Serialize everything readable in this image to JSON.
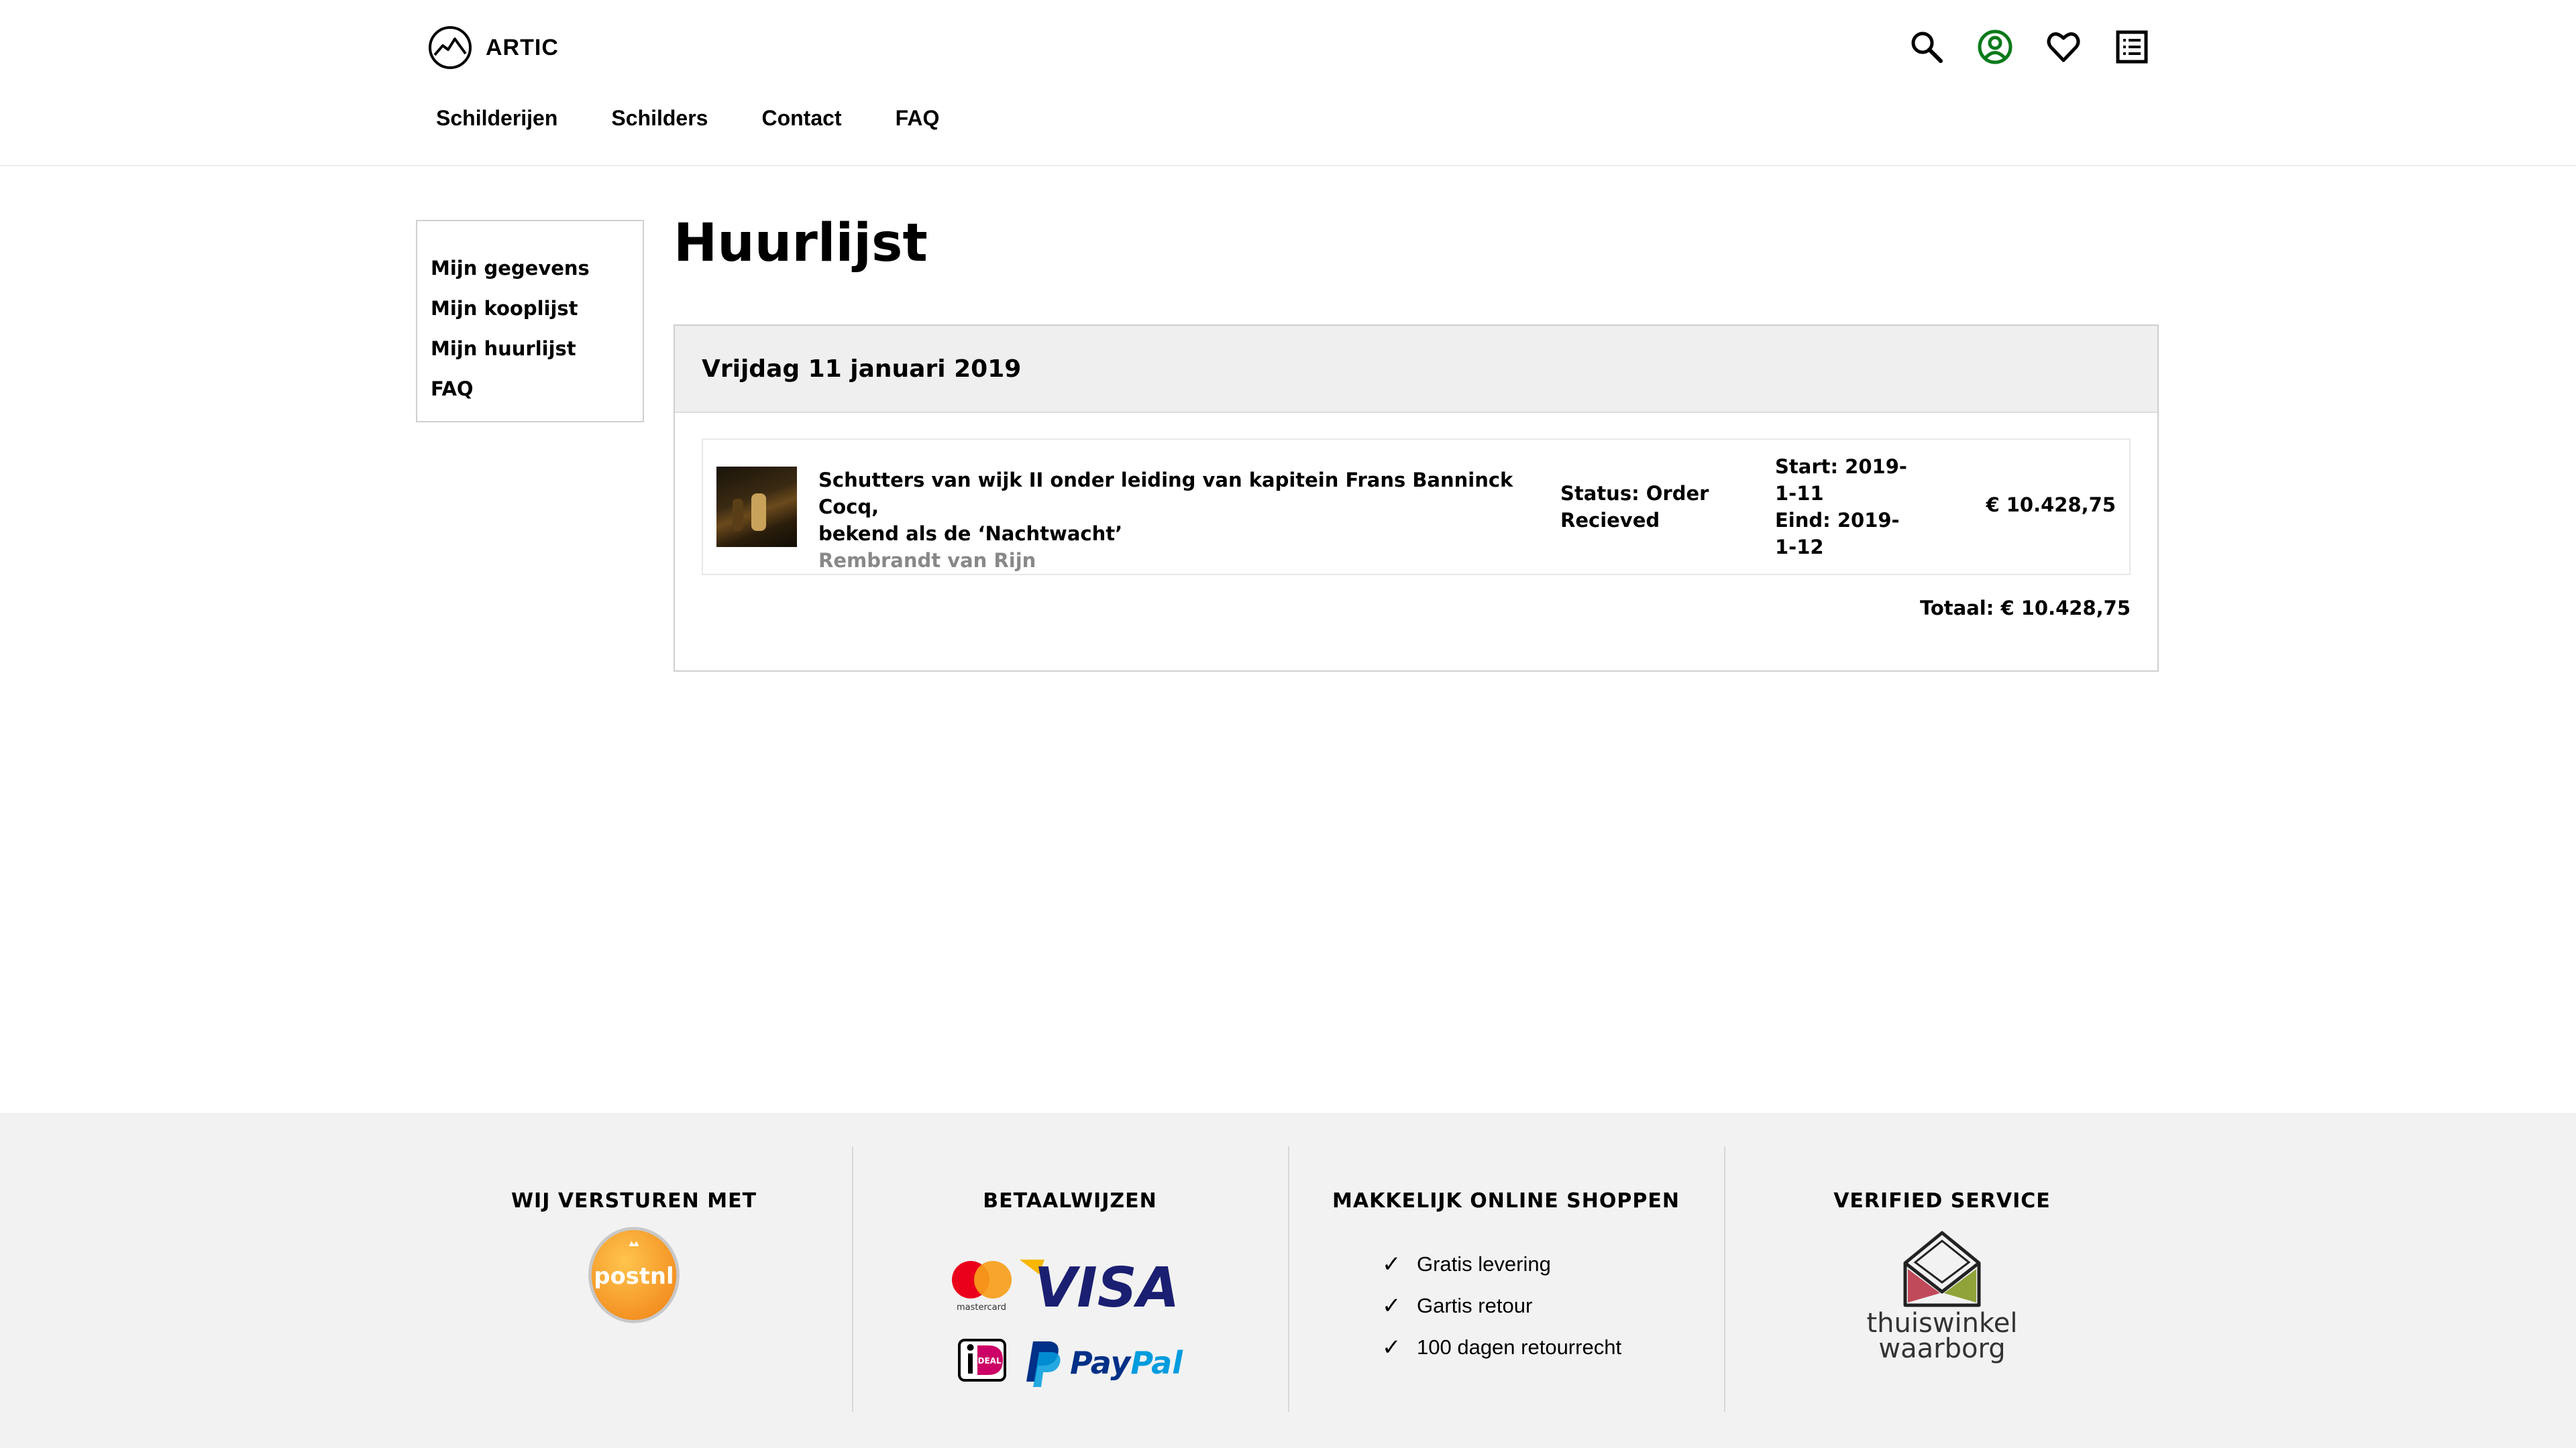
{
  "brand": {
    "name": "ARTIC"
  },
  "nav": [
    "Schilderijen",
    "Schilders",
    "Contact",
    "FAQ"
  ],
  "header_icons": [
    "search-icon",
    "account-icon",
    "heart-icon",
    "list-icon"
  ],
  "colors": {
    "account_icon": "#0a7a1a",
    "panel_bg": "#efefef",
    "footer_bg": "#f2f2f2",
    "muted_text": "#888888"
  },
  "sidebar": [
    "Mijn gegevens",
    "Mijn kooplijst",
    "Mijn huurlijst",
    "FAQ"
  ],
  "page": {
    "title": "Huurlijst"
  },
  "order": {
    "date": "Vrijdag 11 januari 2019",
    "item": {
      "title_line1": "Schutters van wijk II onder leiding van kapitein Frans Banninck Cocq,",
      "title_line2": "bekend als de ‘Nachtwacht’",
      "artist": "Rembrandt van Rijn",
      "status_line1": "Status: Order",
      "status_line2": "Recieved",
      "start_line1": "Start: 2019-",
      "start_line2": "1-11",
      "end_line1": "Eind: 2019-",
      "end_line2": "1-12",
      "price": "€ 10.428,75"
    },
    "total": "Totaal: € 10.428,75"
  },
  "footer": {
    "shipping": {
      "title": "WIJ VERSTUREN MET",
      "logo_text": "postnl"
    },
    "payments": {
      "title": "BETAALWIJZEN",
      "mastercard": "mastercard",
      "visa": "VISA",
      "ideal": "iDEAL",
      "paypal_pay": "Pay",
      "paypal_pal": "Pal"
    },
    "usps": {
      "title": "MAKKELIJK ONLINE SHOPPEN",
      "items": [
        "Gratis levering",
        "Gartis retour",
        "100 dagen retourrecht"
      ]
    },
    "verified": {
      "title": "VERIFIED SERVICE",
      "line1": "thuiswinkel",
      "line2": "waarborg"
    }
  }
}
